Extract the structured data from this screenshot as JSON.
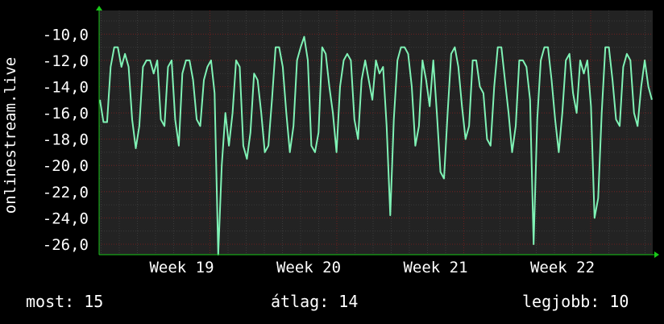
{
  "chart_data": {
    "type": "line",
    "ylabel": "onlinestream.live",
    "xlabel": "",
    "title": "",
    "x_ticks": [
      "Week 19",
      "Week 20",
      "Week 21",
      "Week 22"
    ],
    "y_ticks": [
      "-10,0",
      "-12,0",
      "-14,0",
      "-16,0",
      "-18,0",
      "-20,0",
      "-22,0",
      "-24,0",
      "-26,0"
    ],
    "ylim": [
      -26.8,
      -8.2
    ],
    "grid": true,
    "colors": {
      "background": "#000000",
      "plot_background": "#232323",
      "major_grid": "#6b1d1d",
      "minor_grid": "#3a3a3a",
      "line": "#7ff2b5",
      "axis_arrow": "#19c819",
      "text": "#ffffff"
    },
    "series": [
      {
        "values": [
          -15.0,
          -16.7,
          -16.7,
          -12.5,
          -11.0,
          -11.0,
          -12.5,
          -11.5,
          -12.5,
          -16.5,
          -18.7,
          -17.0,
          -12.5,
          -12.0,
          -12.0,
          -13.0,
          -12.0,
          -16.5,
          -17.0,
          -12.5,
          -12.0,
          -16.5,
          -18.5,
          -13.0,
          -12.0,
          -12.0,
          -13.5,
          -16.5,
          -17.0,
          -13.5,
          -12.5,
          -12.0,
          -14.5,
          -26.8,
          -20.0,
          -16.0,
          -18.5,
          -16.0,
          -12.0,
          -12.5,
          -18.5,
          -19.5,
          -17.5,
          -13.0,
          -13.5,
          -16.0,
          -19.0,
          -18.5,
          -15.0,
          -11.0,
          -11.0,
          -12.5,
          -16.0,
          -19.0,
          -17.0,
          -12.0,
          -11.0,
          -10.2,
          -12.0,
          -18.5,
          -19.0,
          -17.5,
          -11.0,
          -11.5,
          -14.0,
          -16.0,
          -19.0,
          -14.0,
          -12.0,
          -11.5,
          -12.0,
          -16.5,
          -18.0,
          -13.5,
          -12.0,
          -13.5,
          -15.0,
          -12.0,
          -13.0,
          -12.5,
          -17.0,
          -23.8,
          -16.5,
          -12.0,
          -11.0,
          -11.0,
          -11.5,
          -14.0,
          -18.5,
          -17.0,
          -12.0,
          -13.5,
          -15.5,
          -12.0,
          -16.0,
          -20.5,
          -21.0,
          -16.0,
          -11.5,
          -11.0,
          -12.5,
          -15.5,
          -18.0,
          -17.0,
          -12.0,
          -12.0,
          -14.0,
          -14.5,
          -18.0,
          -18.5,
          -14.0,
          -11.0,
          -11.0,
          -13.5,
          -16.0,
          -19.0,
          -17.0,
          -12.0,
          -12.0,
          -12.5,
          -15.0,
          -26.0,
          -16.5,
          -12.0,
          -11.0,
          -11.0,
          -13.5,
          -16.5,
          -19.0,
          -16.0,
          -12.0,
          -11.5,
          -14.5,
          -16.0,
          -12.0,
          -13.0,
          -12.0,
          -15.5,
          -24.0,
          -22.5,
          -16.0,
          -11.0,
          -11.0,
          -13.5,
          -16.5,
          -17.0,
          -12.5,
          -11.5,
          -12.0,
          -16.0,
          -17.0,
          -14.0,
          -12.0,
          -14.0,
          -15.0
        ],
        "color": "#7ff2b5"
      }
    ]
  },
  "legend": {
    "current": "most: 15",
    "average": "átlag: 14",
    "max": "legjobb: 10"
  }
}
